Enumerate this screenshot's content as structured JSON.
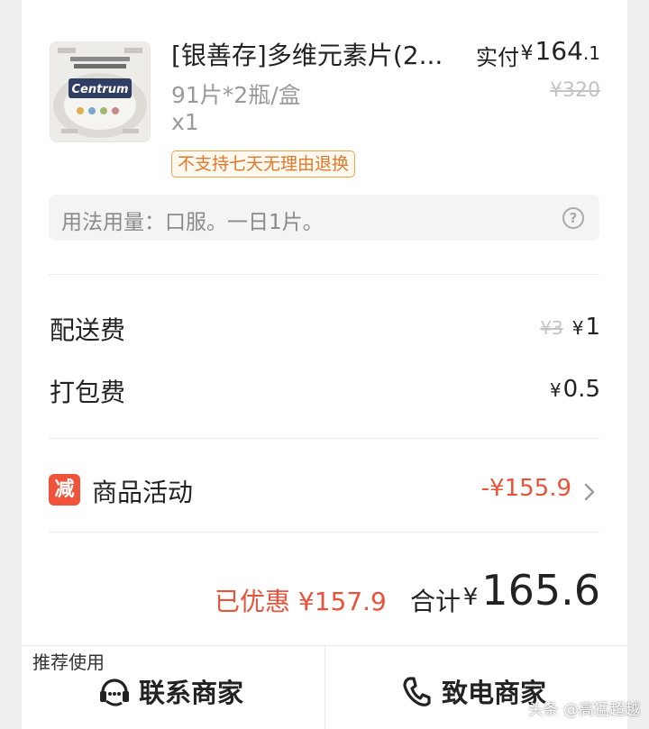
{
  "product": {
    "brand_image_text": "Centrum",
    "title": "[银善存]多维元素片(2...",
    "paid_label": "实付",
    "paid_price_yen": "¥",
    "paid_price_int": "164",
    "paid_price_frac": ".1",
    "original_price": "¥320",
    "spec": "91片*2瓶/盒",
    "quantity": "x1",
    "tag": "不支持七天无理由退换"
  },
  "usage": {
    "text": "用法用量：口服。一日1片。",
    "help_icon": "question-circle-icon"
  },
  "fees": {
    "delivery_label": "配送费",
    "delivery_old": "¥3",
    "delivery_yen": "¥",
    "delivery_value": "1",
    "packing_label": "打包费",
    "packing_yen": "¥",
    "packing_value": "0.5"
  },
  "promotion": {
    "badge": "减",
    "label": "商品活动",
    "value": "-¥155.9"
  },
  "summary": {
    "saved": "已优惠 ¥157.9",
    "total_label": "合计",
    "total_yen": "¥",
    "total_value": "165.6"
  },
  "actions": {
    "contact_label": "联系商家",
    "contact_icon": "chat-headset-icon",
    "call_label": "致电商家",
    "call_icon": "phone-icon",
    "recommend_label": "推荐使用"
  },
  "watermark": "头条 @高猛超越",
  "colors": {
    "accent_red": "#e8533a",
    "tag_orange": "#e0782a",
    "badge_red": "#f0523a"
  }
}
